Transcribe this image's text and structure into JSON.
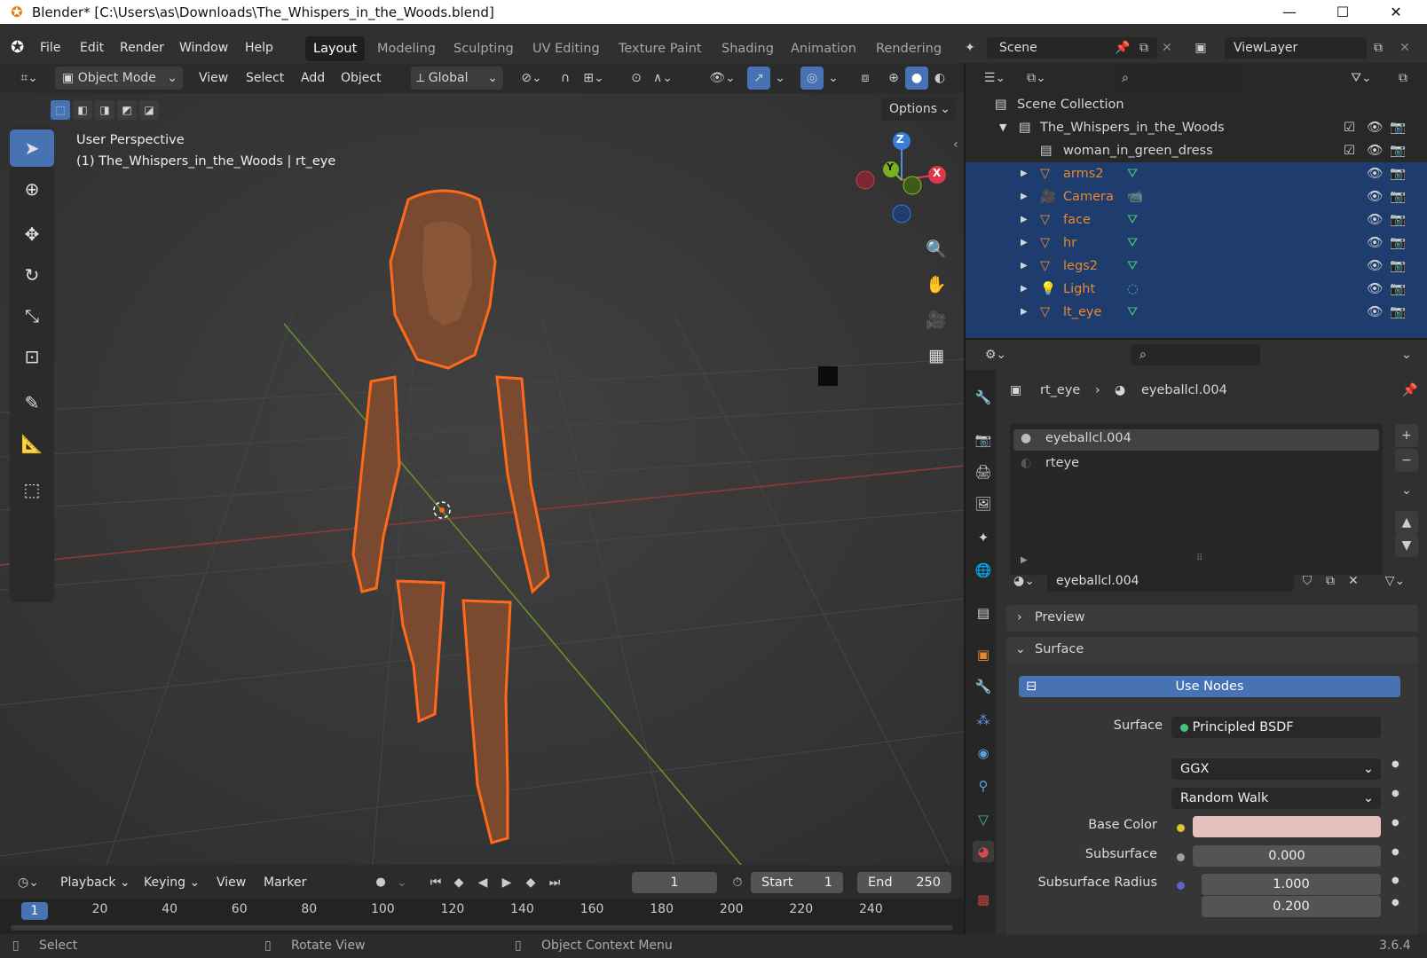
{
  "window": {
    "title": "Blender* [C:\\Users\\as\\Downloads\\The_Whispers_in_the_Woods.blend]"
  },
  "menu": {
    "file": "File",
    "edit": "Edit",
    "render": "Render",
    "window": "Window",
    "help": "Help"
  },
  "workspaces": [
    "Layout",
    "Modeling",
    "Sculpting",
    "UV Editing",
    "Texture Paint",
    "Shading",
    "Animation",
    "Rendering"
  ],
  "scene": {
    "name": "Scene",
    "view_layer": "ViewLayer"
  },
  "viewport_header": {
    "mode": "Object Mode",
    "view": "View",
    "select": "Select",
    "add": "Add",
    "object": "Object",
    "orientation": "Global",
    "options": "Options"
  },
  "viewport": {
    "perspective": "User Perspective",
    "context": "(1) The_Whispers_in_the_Woods | rt_eye"
  },
  "gizmo": {
    "z": "Z",
    "y": "Y",
    "x": "X"
  },
  "outliner": {
    "root": "Scene Collection",
    "collection": "The_Whispers_in_the_Woods",
    "sub": "woman_in_green_dress",
    "objects": [
      "arms2",
      "Camera",
      "face",
      "hr",
      "legs2",
      "Light",
      "lt_eye"
    ]
  },
  "properties": {
    "object": "rt_eye",
    "material": "eyeballcl.004",
    "slots": [
      "eyeballcl.004",
      "rteye"
    ],
    "material_field": "eyeballcl.004",
    "preview": "Preview",
    "surface_section": "Surface",
    "use_nodes": "Use Nodes",
    "surface_label": "Surface",
    "surface_value": "Principled BSDF",
    "distribution": "GGX",
    "subsurface_method": "Random Walk",
    "base_color_label": "Base Color",
    "base_color": "#e5c1bd",
    "subsurface_label": "Subsurface",
    "subsurface_value": "0.000",
    "subsurface_radius_label": "Subsurface Radius",
    "radius": [
      "1.000",
      "0.200"
    ]
  },
  "timeline": {
    "playback": "Playback",
    "keying": "Keying",
    "view": "View",
    "marker": "Marker",
    "current_frame": "1",
    "start_label": "Start",
    "start": "1",
    "end_label": "End",
    "end": "250",
    "ticks": [
      "1",
      "20",
      "40",
      "60",
      "80",
      "100",
      "120",
      "140",
      "160",
      "180",
      "200",
      "220",
      "240"
    ]
  },
  "statusbar": {
    "select": "Select",
    "rotate": "Rotate View",
    "context_menu": "Object Context Menu",
    "version": "3.6.4"
  },
  "colors": {
    "accent": "#4772b3",
    "selection_outline": "#ff6a1a",
    "outliner_selected": "#1e3c6e"
  }
}
